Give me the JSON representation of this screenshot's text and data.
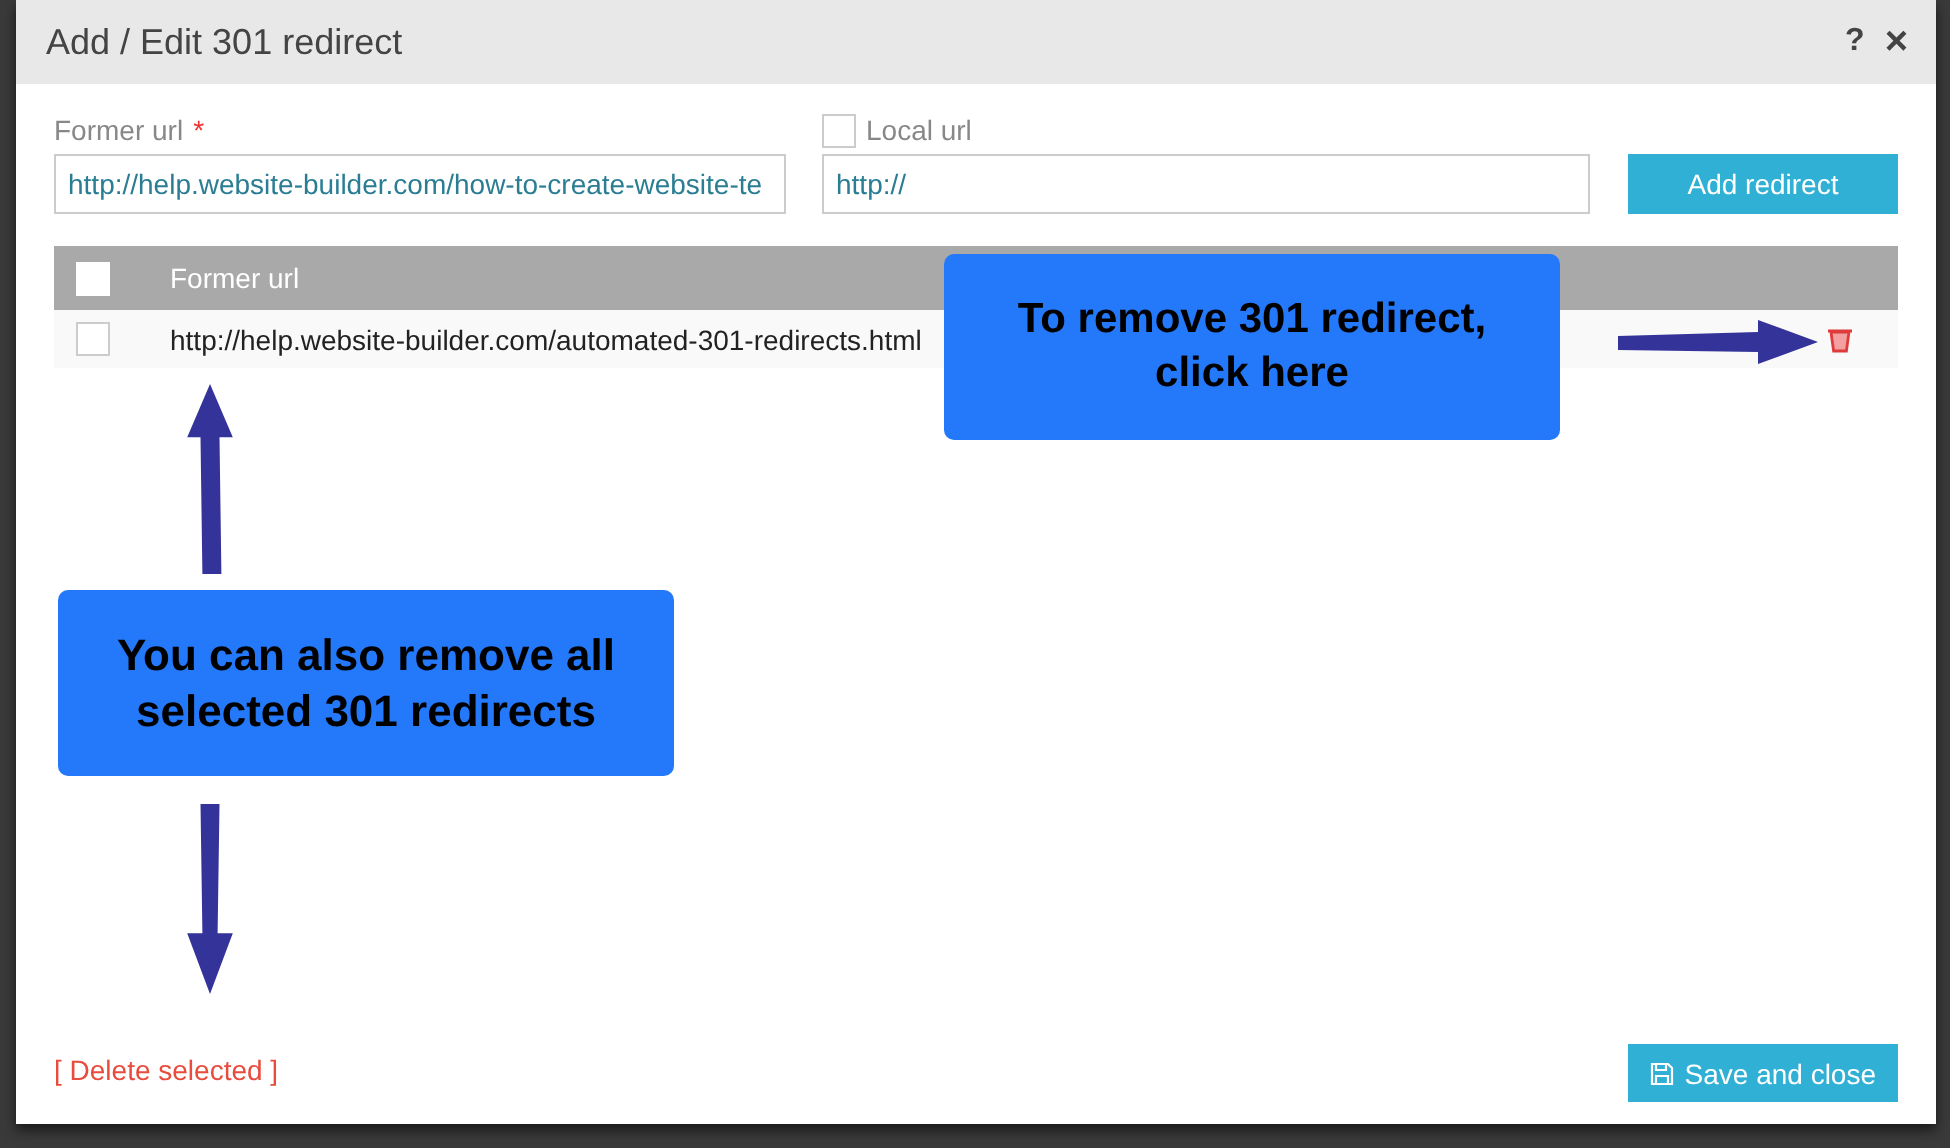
{
  "dialog": {
    "title": "Add / Edit 301 redirect",
    "help": "?",
    "close": "×"
  },
  "form": {
    "former_url": {
      "label": "Former url",
      "required_mark": "*",
      "value": "http://help.website-builder.com/how-to-create-website-te"
    },
    "local_url": {
      "label": "Local url",
      "checked": false,
      "value": "http://"
    },
    "add_button": "Add redirect"
  },
  "table": {
    "select_all_checked": false,
    "columns": [
      "Former url"
    ],
    "rows": [
      {
        "selected": false,
        "former_url": "http://help.website-builder.com/automated-301-redirects.html"
      }
    ]
  },
  "callouts": [
    {
      "text": "To remove 301 redirect, click here"
    },
    {
      "text": "You can also remove all selected 301 redirects"
    }
  ],
  "delete_selected": "[ Delete selected ]",
  "save_button": "Save and close"
}
